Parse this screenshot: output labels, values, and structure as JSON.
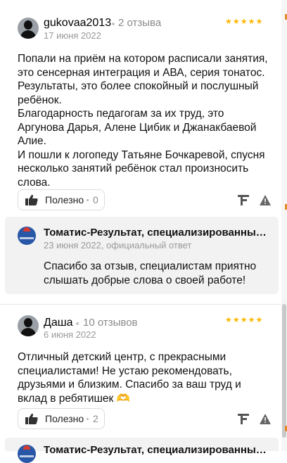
{
  "reviews": [
    {
      "author": "gukovaa2013",
      "reviews_count": "2 отзыва",
      "date": "17 июня 2022",
      "stars": "★★★★★",
      "rating": 5,
      "text": [
        "Попали на приём на котором расписали занятия, это сенсерная интеграция и АВА, серия тонатос. Результаты, это более спокойный и послушный ребёнок.",
        "Благодарность педагогам за их труд, это Аргунова Дарья, Алене Цибик и Джанакбаевой Алие.",
        "И пошли к логопеду Татьяне Бочкаревой, спусня несколько занятий ребёнок стал произносить слова."
      ],
      "useful_label": "Полезно",
      "useful_count": "0",
      "reply": {
        "org": "Томатис-Результат, специализированны…",
        "date": "23 июня 2022, официальный ответ",
        "text": "Спасибо за отзыв, специалистам приятно слышать добрые слова о своей работе!"
      }
    },
    {
      "author": "Даша",
      "reviews_count": "10 отзывов",
      "date": "6 июня 2022",
      "stars": "★★★★★",
      "rating": 5,
      "text": [
        "Отличный детский центр, с прекрасными специалистами! Не устаю рекомендовать, друзьями и близким. Спасибо за ваш труд и вклад в ребятишек 🫶"
      ],
      "useful_label": "Полезно",
      "useful_count": "2",
      "reply": {
        "org": "Томатис-Результат, специализированны…"
      }
    }
  ],
  "colors": {
    "star": "#fcb800",
    "reply_bg": "#f2f2f2",
    "muted": "#999999"
  },
  "icons": [
    "user-avatar-icon",
    "thumbs-up-icon",
    "share-f-icon",
    "warning-icon",
    "org-logo-icon"
  ]
}
